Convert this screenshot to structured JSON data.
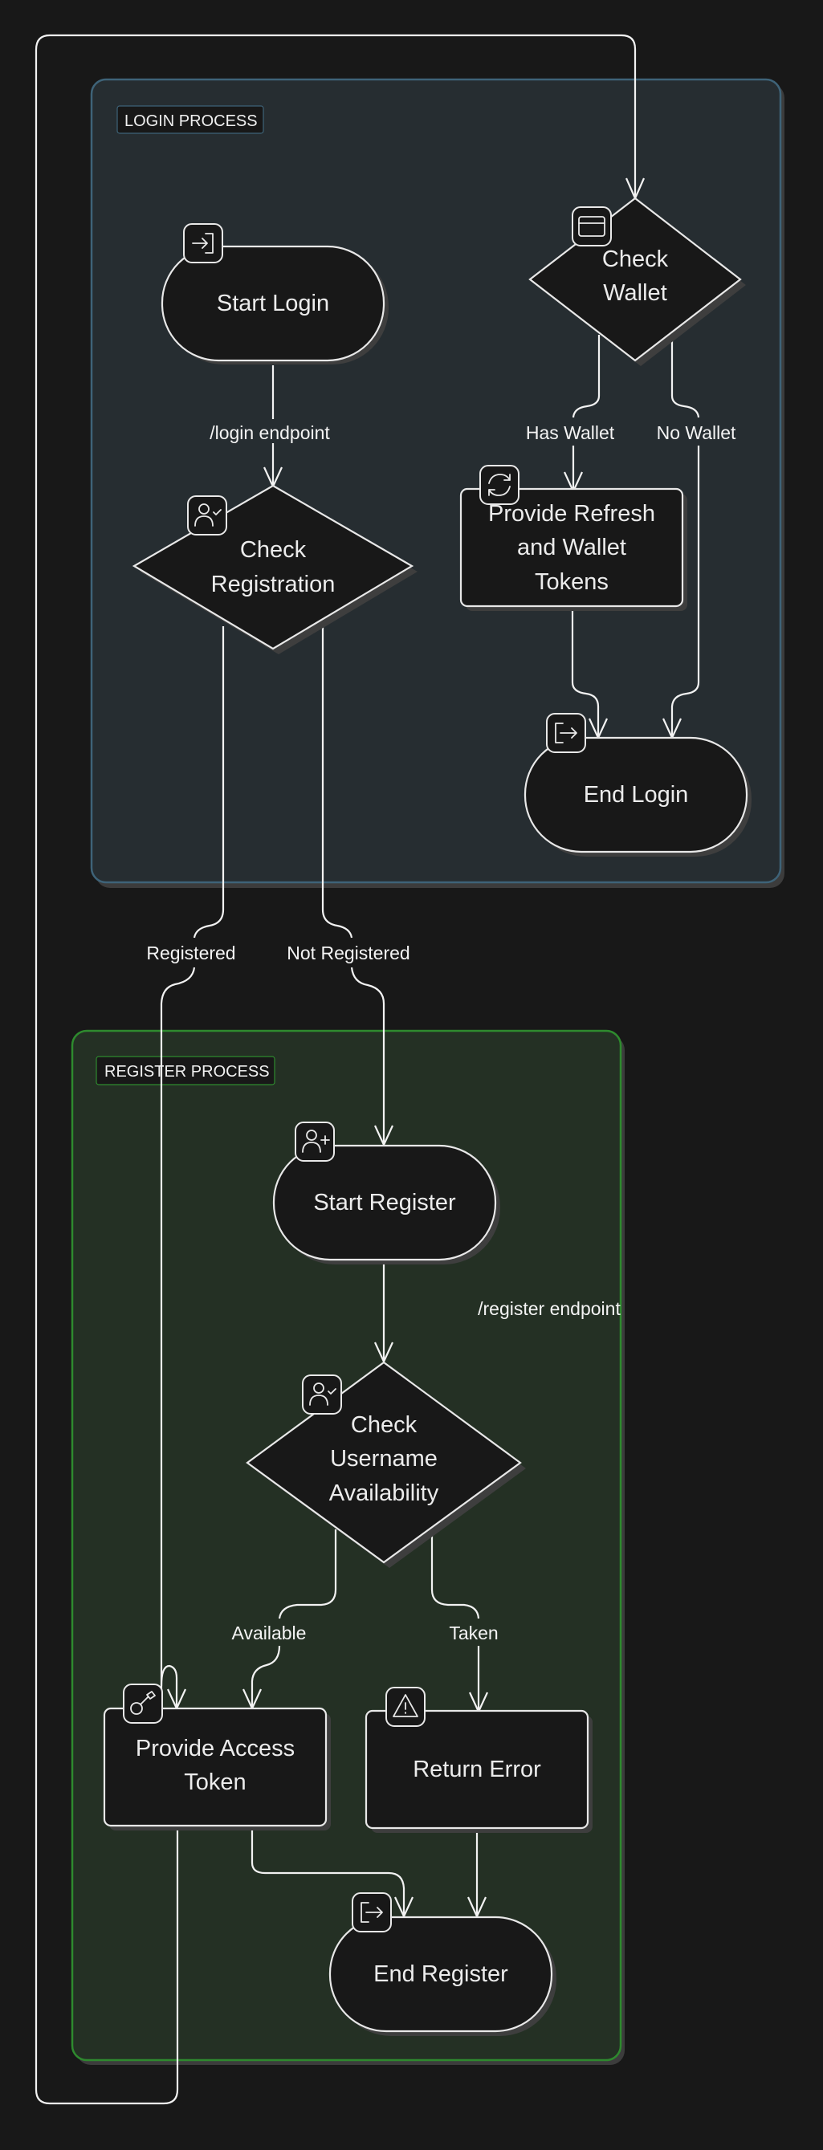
{
  "diagram": {
    "type": "flowchart",
    "colors": {
      "background": "#181818",
      "login_group_fill": "#262d31",
      "login_group_border": "#3e6378",
      "register_group_fill": "#243024",
      "register_group_border": "#2e8a2e",
      "node_fill": "#181818",
      "stroke": "#e8e8e8"
    },
    "groups": {
      "login": {
        "title": "LOGIN PROCESS"
      },
      "register": {
        "title": "REGISTER PROCESS"
      }
    },
    "nodes": {
      "start_login": {
        "lines": [
          "Start Login"
        ],
        "shape": "stadium",
        "icon": "login-icon"
      },
      "check_registration": {
        "lines": [
          "Check",
          "Registration"
        ],
        "shape": "diamond",
        "icon": "user-check-icon"
      },
      "check_wallet": {
        "lines": [
          "Check",
          "Wallet"
        ],
        "shape": "diamond",
        "icon": "credit-card-icon"
      },
      "provide_refresh": {
        "lines": [
          "Provide Refresh",
          "and Wallet",
          "Tokens"
        ],
        "shape": "rect",
        "icon": "refresh-icon"
      },
      "end_login": {
        "lines": [
          "End Login"
        ],
        "shape": "stadium",
        "icon": "logout-icon"
      },
      "start_register": {
        "lines": [
          "Start Register"
        ],
        "shape": "stadium",
        "icon": "user-plus-icon"
      },
      "check_username": {
        "lines": [
          "Check",
          "Username",
          "Availability"
        ],
        "shape": "diamond",
        "icon": "user-check-icon"
      },
      "provide_access": {
        "lines": [
          "Provide Access",
          "Token"
        ],
        "shape": "rect",
        "icon": "key-icon"
      },
      "return_error": {
        "lines": [
          "Return Error"
        ],
        "shape": "rect",
        "icon": "warning-icon"
      },
      "end_register": {
        "lines": [
          "End Register"
        ],
        "shape": "stadium",
        "icon": "logout-icon"
      }
    },
    "edges": [
      {
        "from": "start_login",
        "to": "check_registration",
        "label": "/login endpoint"
      },
      {
        "from": "check_registration",
        "to": "provide_access",
        "label": "Registered"
      },
      {
        "from": "check_registration",
        "to": "start_register",
        "label": "Not Registered"
      },
      {
        "from": "check_wallet",
        "to": "provide_refresh",
        "label": "Has Wallet"
      },
      {
        "from": "check_wallet",
        "to": "end_login",
        "label": "No Wallet"
      },
      {
        "from": "provide_refresh",
        "to": "end_login",
        "label": ""
      },
      {
        "from": "start_register",
        "to": "check_username",
        "label": "/register endpoint"
      },
      {
        "from": "check_username",
        "to": "provide_access",
        "label": "Available"
      },
      {
        "from": "check_username",
        "to": "return_error",
        "label": "Taken"
      },
      {
        "from": "provide_access",
        "to": "end_register",
        "label": ""
      },
      {
        "from": "return_error",
        "to": "end_register",
        "label": ""
      },
      {
        "from": "provide_access",
        "to": "check_wallet",
        "label": ""
      }
    ]
  }
}
